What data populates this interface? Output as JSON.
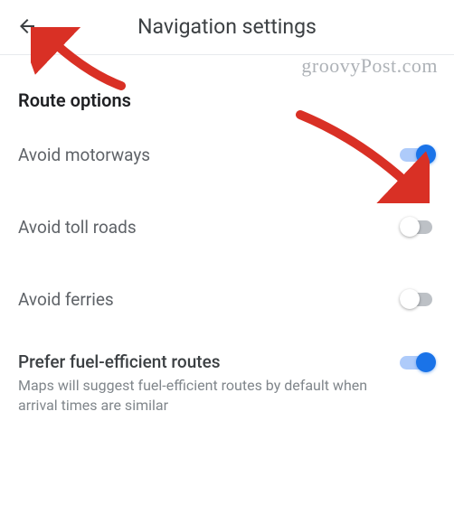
{
  "header": {
    "title": "Navigation settings"
  },
  "watermark": "groovyPost.com",
  "section": {
    "title": "Route options",
    "options": [
      {
        "label": "Avoid motorways",
        "enabled": true
      },
      {
        "label": "Avoid toll roads",
        "enabled": false
      },
      {
        "label": "Avoid ferries",
        "enabled": false
      },
      {
        "label": "Prefer fuel-efficient routes",
        "enabled": true,
        "description": "Maps will suggest fuel-efficient routes by default when arrival times are similar"
      }
    ]
  },
  "annotations": {
    "arrow_color": "#d93025"
  }
}
